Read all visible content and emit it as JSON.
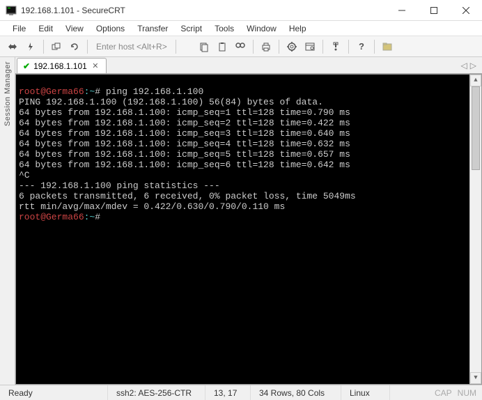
{
  "titlebar": {
    "text": "192.168.1.101 - SecureCRT"
  },
  "menubar": {
    "items": [
      "File",
      "Edit",
      "View",
      "Options",
      "Transfer",
      "Script",
      "Tools",
      "Window",
      "Help"
    ]
  },
  "toolbar": {
    "enter_host": "Enter host <Alt+R>"
  },
  "sidebar": {
    "label": "Session Manager"
  },
  "tab": {
    "label": "192.168.1.101"
  },
  "terminal": {
    "prompt_user": "root@Germa66",
    "lines": [
      "# ping 192.168.1.100",
      "PING 192.168.1.100 (192.168.1.100) 56(84) bytes of data.",
      "64 bytes from 192.168.1.100: icmp_seq=1 ttl=128 time=0.790 ms",
      "64 bytes from 192.168.1.100: icmp_seq=2 ttl=128 time=0.422 ms",
      "64 bytes from 192.168.1.100: icmp_seq=3 ttl=128 time=0.640 ms",
      "64 bytes from 192.168.1.100: icmp_seq=4 ttl=128 time=0.632 ms",
      "64 bytes from 192.168.1.100: icmp_seq=5 ttl=128 time=0.657 ms",
      "64 bytes from 192.168.1.100: icmp_seq=6 ttl=128 time=0.642 ms",
      "^C",
      "--- 192.168.1.100 ping statistics ---",
      "6 packets transmitted, 6 received, 0% packet loss, time 5049ms",
      "rtt min/avg/max/mdev = 0.422/0.630/0.790/0.110 ms"
    ],
    "prompt_end": "#"
  },
  "statusbar": {
    "ready": "Ready",
    "connection": "ssh2: AES-256-CTR",
    "position": "13,  17",
    "dimensions": "34 Rows, 80 Cols",
    "os": "Linux",
    "caps": "CAP",
    "num": "NUM"
  }
}
